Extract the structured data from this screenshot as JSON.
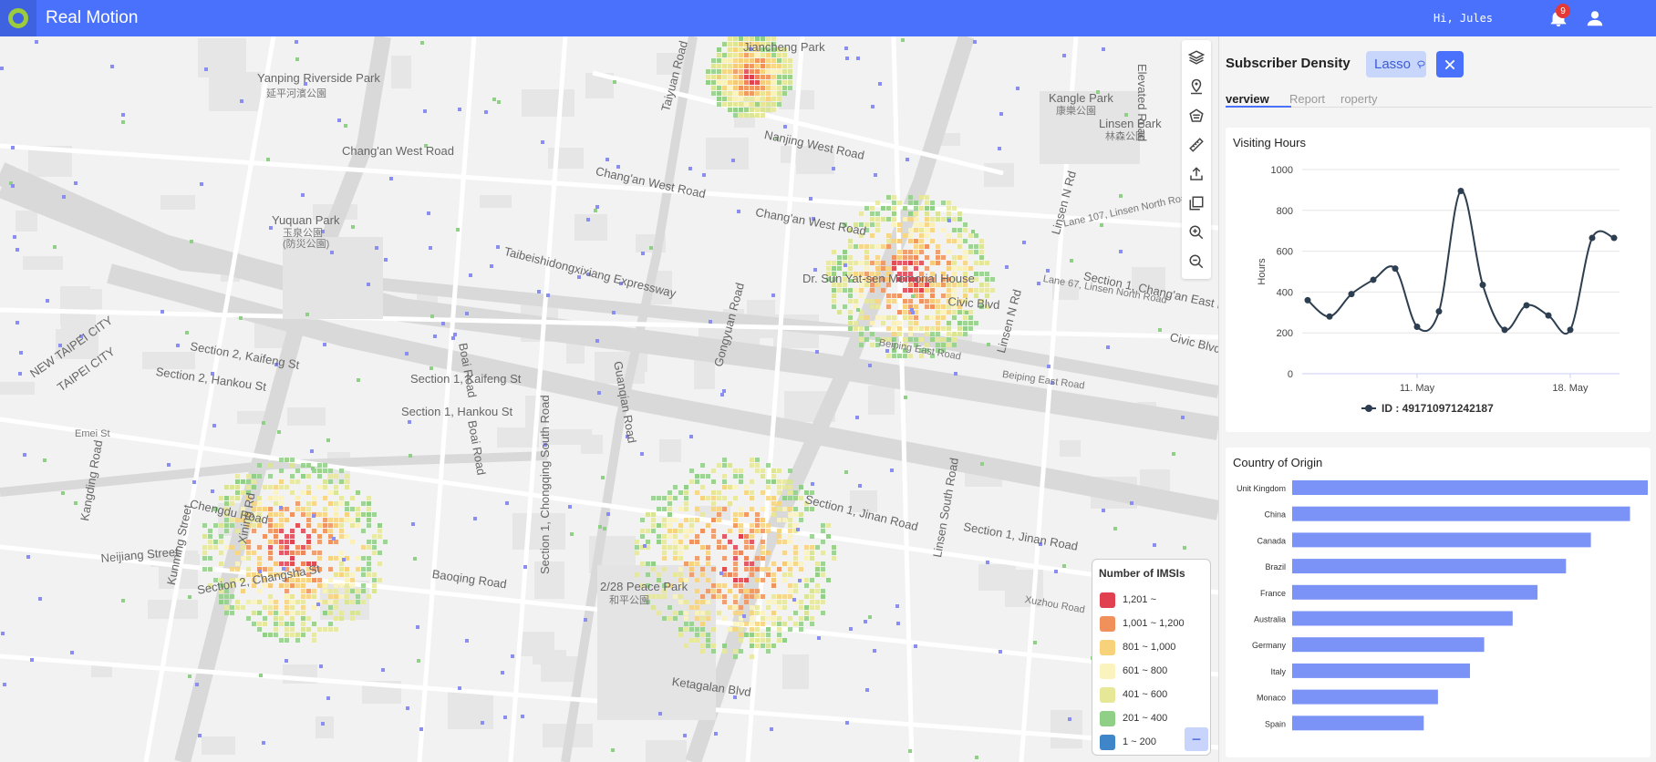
{
  "app": {
    "title": "Real Motion",
    "greeting": "Hi, Jules",
    "notification_count": "9",
    "brand_color": "#4a71fb"
  },
  "toolbar": {
    "tools": [
      {
        "name": "layers-icon"
      },
      {
        "name": "pin-location-icon"
      },
      {
        "name": "polygon-lasso-icon"
      },
      {
        "name": "ruler-icon"
      },
      {
        "name": "export-icon"
      },
      {
        "name": "copy-icon"
      },
      {
        "name": "zoom-in-icon"
      },
      {
        "name": "zoom-out-icon"
      }
    ]
  },
  "map_labels": [
    {
      "text": "Yanping Riverside Park"
    },
    {
      "text": "延平河濱公園"
    },
    {
      "text": "Jiancheng Park"
    },
    {
      "text": "Kangle Park"
    },
    {
      "text": "康樂公園"
    },
    {
      "text": "Linsen Park"
    },
    {
      "text": "林森公園"
    },
    {
      "text": "Chang'an West Road"
    },
    {
      "text": "Chang'an West Road"
    },
    {
      "text": "Chang'an West Road"
    },
    {
      "text": "Nanjing West Road"
    },
    {
      "text": "Taiyuan Road"
    },
    {
      "text": "Elevated Road"
    },
    {
      "text": "Yuquan Park"
    },
    {
      "text": "玉泉公園"
    },
    {
      "text": "(防災公園)"
    },
    {
      "text": "Taibeishidongxixiang Expressway"
    },
    {
      "text": "Dr. Sun Yat-sen Memorial House"
    },
    {
      "text": "Civic Blvd"
    },
    {
      "text": "Civic Blvd"
    },
    {
      "text": "Section 1, Chang'an East R"
    },
    {
      "text": "Lane 67, Linsen North Road"
    },
    {
      "text": "Lane 107, Linsen North Road"
    },
    {
      "text": "Linsen N Rd"
    },
    {
      "text": "Section 2, Kaifeng St"
    },
    {
      "text": "Section 2, Hankou St"
    },
    {
      "text": "Section 1, Kaifeng St"
    },
    {
      "text": "Section 1, Hankou St"
    },
    {
      "text": "Boai Road"
    },
    {
      "text": "Boai Road"
    },
    {
      "text": "Guanqian Road"
    },
    {
      "text": "Gongyuan Road"
    },
    {
      "text": "Beiping East Road"
    },
    {
      "text": "Beiping East Road"
    },
    {
      "text": "Linsen N Rd"
    },
    {
      "text": "NEW TAIPEI CITY"
    },
    {
      "text": "TAIPEI CITY"
    },
    {
      "text": "Chengdu Road"
    },
    {
      "text": "Neijiang Street"
    },
    {
      "text": "Kunming Street"
    },
    {
      "text": "Section 2, Changsha St"
    },
    {
      "text": "Baoqing Road"
    },
    {
      "text": "2/28 Peace Park"
    },
    {
      "text": "和平公園"
    },
    {
      "text": "Section 1, Jinan Road"
    },
    {
      "text": "Section 1, Jinan Road"
    },
    {
      "text": "Linsen South Road"
    },
    {
      "text": "Xuzhou Road"
    },
    {
      "text": "Ketagalan Blvd"
    },
    {
      "text": "Section 1, Chongqing South Road"
    },
    {
      "text": "Kangding Road"
    },
    {
      "text": "Emei St"
    },
    {
      "text": "Xining Rd"
    }
  ],
  "legend": {
    "title": "Number of IMSIs",
    "toggle": "−",
    "items": [
      {
        "label": "1,201 ~",
        "color": "#e04050"
      },
      {
        "label": "1,001 ~ 1,200",
        "color": "#f0905a"
      },
      {
        "label": "801 ~ 1,000",
        "color": "#f7d27a"
      },
      {
        "label": "601 ~ 800",
        "color": "#fbf3bd"
      },
      {
        "label": "401 ~ 600",
        "color": "#e6e898"
      },
      {
        "label": "201 ~ 400",
        "color": "#8fcf86"
      },
      {
        "label": "1 ~ 200",
        "color": "#3f86c8"
      }
    ]
  },
  "panel": {
    "title": "Subscriber Density",
    "chip_label": "Lasso",
    "tabs": [
      {
        "label": "verview",
        "active": true
      },
      {
        "label": "Report",
        "active": false
      },
      {
        "label": "roperty",
        "active": false
      }
    ]
  },
  "chart_data": [
    {
      "type": "line",
      "title": "Visiting Hours",
      "ylabel": "Hours",
      "xlabel": "",
      "ylim": [
        0,
        1000
      ],
      "yticks": [
        0,
        200,
        400,
        600,
        800,
        1000
      ],
      "xtick_labels": [
        "11. May",
        "18. May"
      ],
      "x": [
        "6. May",
        "7. May",
        "8. May",
        "9. May",
        "10. May",
        "11. May",
        "12. May",
        "13. May",
        "14. May",
        "15. May",
        "16. May",
        "17. May",
        "18. May",
        "19. May",
        "20. May"
      ],
      "series": [
        {
          "name": "ID : 491710971242187",
          "color": "#2d3e50",
          "values": [
            360,
            280,
            390,
            460,
            515,
            230,
            305,
            895,
            435,
            215,
            335,
            285,
            215,
            665,
            665
          ]
        }
      ],
      "grid": true,
      "legend_position": "bottom"
    },
    {
      "type": "bar",
      "title": "Country of Origin",
      "orientation": "horizontal",
      "color": "#7b93f7",
      "categories": [
        "Unit Kingdom",
        "China",
        "Canada",
        "Brazil",
        "France",
        "Australia",
        "Germany",
        "Italy",
        "Monaco",
        "Spain"
      ],
      "values": [
        100,
        95,
        84,
        77,
        69,
        62,
        54,
        50,
        41,
        37
      ]
    }
  ]
}
